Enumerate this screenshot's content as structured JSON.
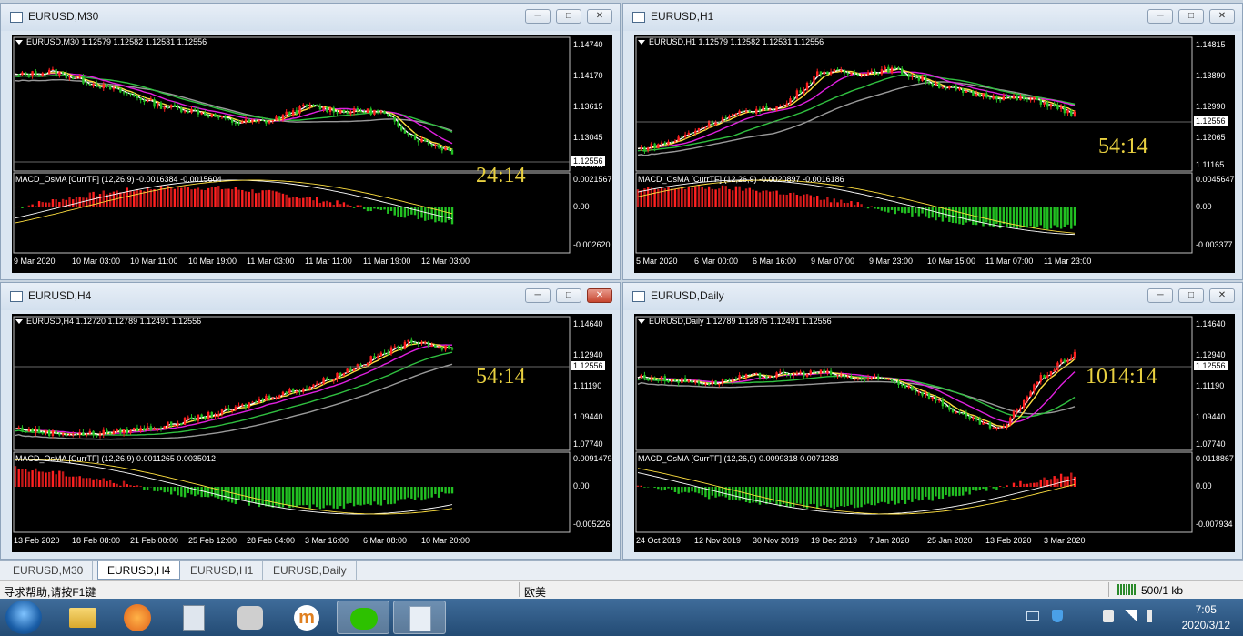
{
  "windows": [
    {
      "id": "m30",
      "title": "EURUSD,M30",
      "info": "EURUSD,M30  1.12579 1.12582 1.12531 1.12556",
      "price_labels": [
        "1.14740",
        "1.14170",
        "1.13615",
        "1.13045",
        "1.12556"
      ],
      "current_price": "1.12556",
      "timer": "24:14",
      "macd_label": "MACD_OsMA [CurrTF] (12,26,9) -0.0016384 -0.0015604",
      "macd_labels": [
        "0.0021567",
        "0.00",
        "-0.002620"
      ],
      "time_labels": [
        "9 Mar 2020",
        "10 Mar 03:00",
        "10 Mar 11:00",
        "10 Mar 19:00",
        "11 Mar 03:00",
        "11 Mar 11:00",
        "11 Mar 19:00",
        "12 Mar 03:00"
      ],
      "close_red": false
    },
    {
      "id": "h1",
      "title": "EURUSD,H1",
      "info": "EURUSD,H1  1.12579 1.12582 1.12531 1.12556",
      "price_labels": [
        "1.14815",
        "1.13890",
        "1.12990",
        "1.12065",
        "1.11165"
      ],
      "current_price": "1.12556",
      "timer": "54:14",
      "macd_label": "MACD_OsMA [CurrTF] (12,26,9) -0.0020897 -0.0016186",
      "macd_labels": [
        "0.0045647",
        "0.00",
        "-0.003377"
      ],
      "time_labels": [
        "5 Mar 2020",
        "6 Mar 00:00",
        "6 Mar 16:00",
        "9 Mar 07:00",
        "9 Mar 23:00",
        "10 Mar 15:00",
        "11 Mar 07:00",
        "11 Mar 23:00"
      ],
      "close_red": false
    },
    {
      "id": "h4",
      "title": "EURUSD,H4",
      "info": "EURUSD,H4  1.12720 1.12789 1.12491 1.12556",
      "price_labels": [
        "1.14640",
        "1.12940",
        "1.11190",
        "1.09440",
        "1.07740"
      ],
      "current_price": "1.12556",
      "timer": "54:14",
      "macd_label": "MACD_OsMA [CurrTF] (12,26,9) 0.0011265 0.0035012",
      "macd_labels": [
        "0.0091479",
        "0.00",
        "-0.005226"
      ],
      "time_labels": [
        "13 Feb 2020",
        "18 Feb 08:00",
        "21 Feb 00:00",
        "25 Feb 12:00",
        "28 Feb 04:00",
        "3 Mar 16:00",
        "6 Mar 08:00",
        "10 Mar 20:00"
      ],
      "close_red": true
    },
    {
      "id": "daily",
      "title": "EURUSD,Daily",
      "info": "EURUSD,Daily  1.12789 1.12875 1.12491 1.12556",
      "price_labels": [
        "1.14640",
        "1.12940",
        "1.11190",
        "1.09440",
        "1.07740"
      ],
      "current_price": "1.12556",
      "timer": "1014:14",
      "macd_label": "MACD_OsMA [CurrTF] (12,26,9) 0.0099318 0.0071283",
      "macd_labels": [
        "0.0118867",
        "0.00",
        "-0.007934"
      ],
      "time_labels": [
        "24 Oct 2019",
        "12 Nov 2019",
        "30 Nov 2019",
        "19 Dec 2019",
        "7 Jan 2020",
        "25 Jan 2020",
        "13 Feb 2020",
        "3 Mar 2020"
      ],
      "close_red": false
    }
  ],
  "tabs": [
    "EURUSD,M30",
    "EURUSD,H4",
    "EURUSD,H1",
    "EURUSD,Daily"
  ],
  "active_tab": "EURUSD,H4",
  "status": {
    "help": "寻求帮助,请按F1键",
    "profile": "欧美",
    "traffic": "500/1 kb"
  },
  "taskbar": {
    "time": "7:05",
    "date": "2020/3/12"
  },
  "colors": {
    "bull": "#ff2020",
    "bear": "#22c022",
    "ma_fast": "#ffffff",
    "ma_yellow": "#ffe040",
    "ma_magenta": "#e020e0",
    "ma_green": "#30c040",
    "ma_gray": "#9a9a9a",
    "timer": "#e8d040"
  }
}
